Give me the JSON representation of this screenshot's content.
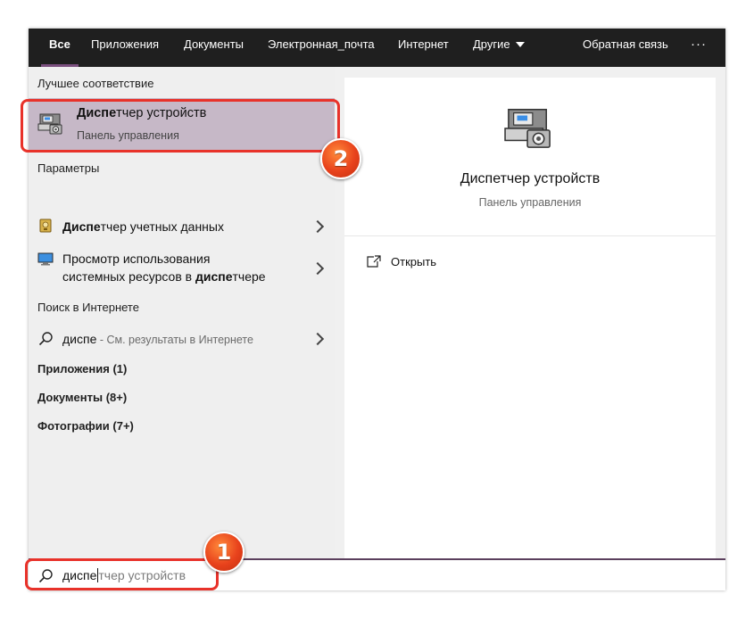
{
  "nav": {
    "tabs": [
      "Все",
      "Приложения",
      "Документы",
      "Электронная_почта",
      "Интернет",
      "Другие"
    ],
    "feedback": "Обратная связь",
    "more": "···"
  },
  "left": {
    "best_match_header": "Лучшее соответствие",
    "best_match": {
      "title_bold": "Диспе",
      "title_rest": "тчер устройств",
      "subtitle": "Панель управления"
    },
    "settings_header": "Параметры",
    "settings_items": [
      {
        "bold": "Диспе",
        "rest": "тчер учетных данных",
        "icon": "credential-manager-icon"
      },
      {
        "line1": "Просмотр использования",
        "line2_start": "системных ресурсов в ",
        "line2_bold": "диспе",
        "line2_end": "тчере",
        "icon": "monitor-icon"
      }
    ],
    "web_header": "Поиск в Интернете",
    "web_item": {
      "query": "диспе",
      "suffix": " - См. результаты в Интернете"
    },
    "apps": "Приложения (1)",
    "docs": "Документы (8+)",
    "photos": "Фотографии (7+)"
  },
  "right": {
    "title": "Диспетчер устройств",
    "subtitle": "Панель управления",
    "open": "Открыть"
  },
  "search": {
    "typed": "диспе",
    "suggestion": "тчер устройств"
  },
  "annotations": {
    "badge1": "1",
    "badge2": "2"
  },
  "colors": {
    "accent": "#7a4f7e",
    "highlight": "#e8322a",
    "selected_row": "#c6b8c7"
  }
}
